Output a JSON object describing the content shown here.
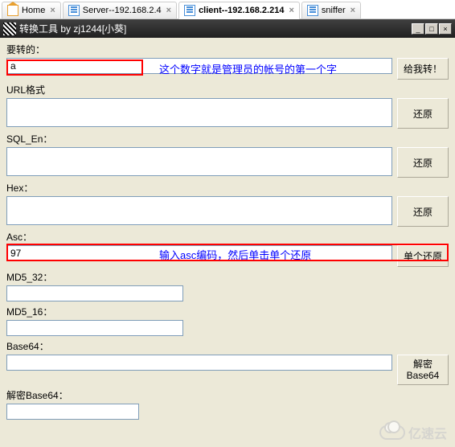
{
  "tabs": [
    {
      "label": "Home"
    },
    {
      "label": "Server--192.168.2.4"
    },
    {
      "label": "client--192.168.2.214"
    },
    {
      "label": "sniffer"
    }
  ],
  "window": {
    "title": "转换工具 by zj1244[小葵]"
  },
  "fields": {
    "convert": {
      "label": "要转的：",
      "value": "a",
      "button": "给我转！",
      "note": "这个数字就是管理员的帐号的第一个字"
    },
    "url": {
      "label": "URL格式",
      "value": "",
      "button": "还原"
    },
    "sqlen": {
      "label": "SQL_En：",
      "value": "",
      "button": "还原"
    },
    "hex": {
      "label": "Hex：",
      "value": "",
      "button": "还原"
    },
    "asc": {
      "label": "Asc：",
      "value": "97",
      "button": "单个还原",
      "note": "输入asc编码，然后单击单个还原"
    },
    "md532": {
      "label": "MD5_32：",
      "value": ""
    },
    "md516": {
      "label": "MD5_16：",
      "value": ""
    },
    "base64": {
      "label": "Base64：",
      "value": "",
      "button": "解密Base64"
    },
    "decbase64": {
      "label": "解密Base64：",
      "value": ""
    }
  },
  "watermark": "亿速云"
}
